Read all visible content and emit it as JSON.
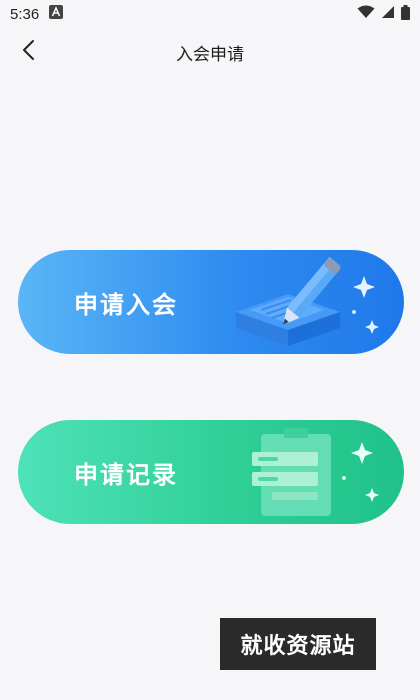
{
  "status_bar": {
    "time": "5:36"
  },
  "header": {
    "title": "入会申请"
  },
  "actions": [
    {
      "label": "申请入会",
      "illustration": "pencil-book-icon",
      "color_start": "#5ab6f6",
      "color_end": "#1f78ea"
    },
    {
      "label": "申请记录",
      "illustration": "clipboard-list-icon",
      "color_start": "#4ee2b8",
      "color_end": "#20c18a"
    }
  ],
  "watermark": {
    "text": "就收资源站"
  }
}
